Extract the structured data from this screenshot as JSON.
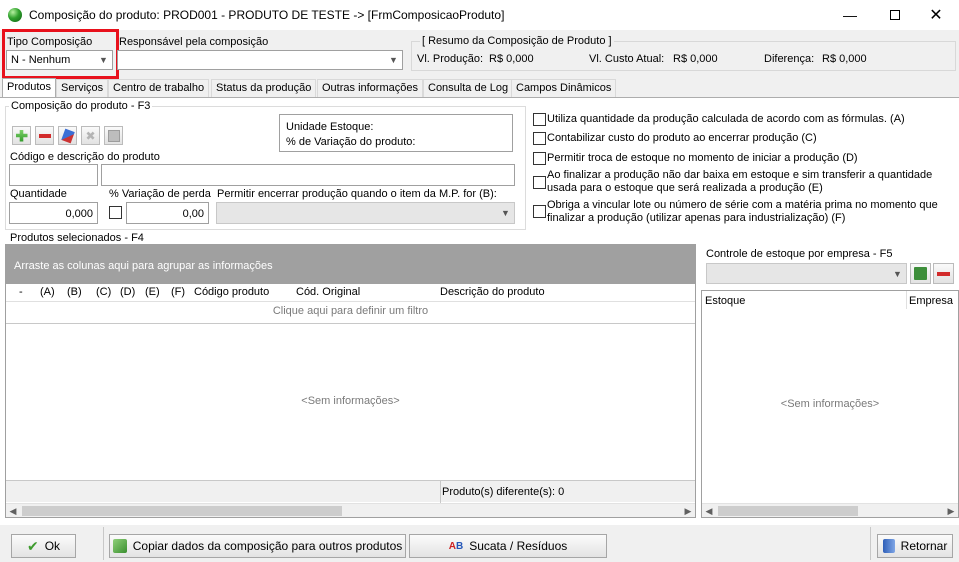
{
  "window": {
    "title": "Composição do produto: PROD001 - PRODUTO DE TESTE -> [FrmComposicaoProduto]"
  },
  "header": {
    "tipo_label": "Tipo Composição",
    "tipo_value": "N - Nenhum",
    "responsavel_label": "Responsável pela composição",
    "responsavel_value": "",
    "resumo_title": "[ Resumo da Composição de Produto ]",
    "vl_producao_label": "Vl. Produção:",
    "vl_producao_value": "R$ 0,000",
    "vl_custo_label": "Vl. Custo Atual:",
    "vl_custo_value": "R$ 0,000",
    "diferenca_label": "Diferença:",
    "diferenca_value": "R$ 0,000"
  },
  "tabs": [
    {
      "label": "Produtos"
    },
    {
      "label": "Serviços"
    },
    {
      "label": "Centro de trabalho"
    },
    {
      "label": "Status da produção"
    },
    {
      "label": "Outras informações"
    },
    {
      "label": "Consulta de Log"
    },
    {
      "label": "Campos Dinâmicos"
    }
  ],
  "composicao": {
    "title": "Composição do produto - F3",
    "unidade_estoque_label": "Unidade Estoque:",
    "variacao_produto_label": "% de Variação do produto:",
    "codigo_label": "Código e descrição do produto",
    "quantidade_label": "Quantidade",
    "quantidade_value": "0,000",
    "variacao_perda_label": "% Variação de perda",
    "variacao_perda_value": "0,00",
    "permitir_label": "Permitir encerrar produção quando o item da M.P. for (B):"
  },
  "options": [
    {
      "label": "Utiliza quantidade da produção calculada de acordo com as fórmulas. (A)",
      "checked": false
    },
    {
      "label": "Contabilizar custo do produto ao encerrar produção (C)",
      "checked": false
    },
    {
      "label": "Permitir troca de estoque no momento de iniciar a produção (D)",
      "checked": false
    },
    {
      "label_line1": "Ao finalizar a produção não dar baixa em estoque e sim transferir a quantidade",
      "label_line2": "usada para o estoque que será realizada a produção (E)",
      "checked": false
    },
    {
      "label_line1": "Obriga a vincular lote ou número de série com a matéria prima no momento que",
      "label_line2": "finalizar a produção (utilizar apenas para industrialização) (F)",
      "checked": false
    }
  ],
  "selecionados": {
    "title": "Produtos selecionados - F4",
    "group_hint": "Arraste as colunas aqui para agrupar as informações",
    "columns": [
      "-",
      "(A)",
      "(B)",
      "(C)",
      "(D)",
      "(E)",
      "(F)",
      "Código produto",
      "Cód. Original",
      "Descrição do produto"
    ],
    "filter_hint": "Clique aqui para definir um filtro",
    "empty": "<Sem informações>",
    "footer": "Produto(s) diferente(s): 0"
  },
  "estoque": {
    "title": "Controle de estoque por empresa - F5",
    "col_estoque": "Estoque",
    "col_empresa": "Empresa",
    "empty": "<Sem informações>"
  },
  "buttons": {
    "ok": "Ok",
    "copiar": "Copiar dados da composição para outros produtos",
    "sucata": "Sucata / Resíduos",
    "retornar": "Retornar"
  },
  "colors": {
    "highlight": "#e8111c",
    "grid_header": "#a0a0a0"
  }
}
